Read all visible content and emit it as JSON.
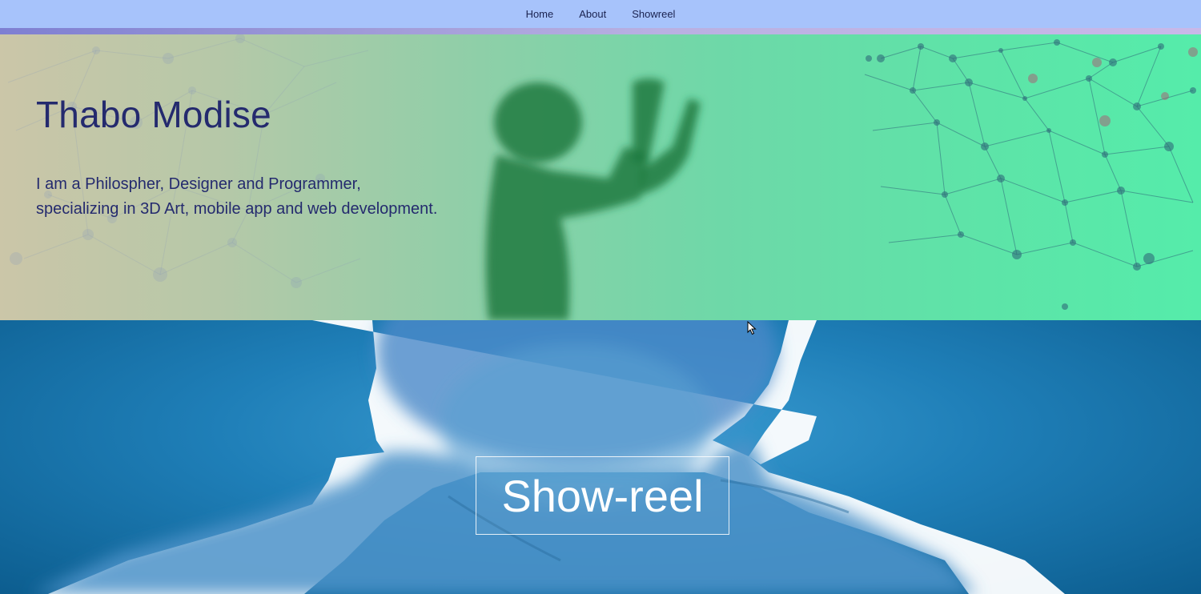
{
  "nav": {
    "items": [
      {
        "label": "Home"
      },
      {
        "label": "About"
      },
      {
        "label": "Showreel"
      }
    ]
  },
  "hero": {
    "title": "Thabo Modise",
    "description_line1": "I am a Philospher, Designer and Programmer,",
    "description_line2": "specializing in 3D Art, mobile app and web development."
  },
  "showreel": {
    "button_label": "Show-reel"
  },
  "colors": {
    "nav_bg": "#a7c3fb",
    "hero_text": "#242a6e",
    "showreel_text": "#ffffff"
  }
}
